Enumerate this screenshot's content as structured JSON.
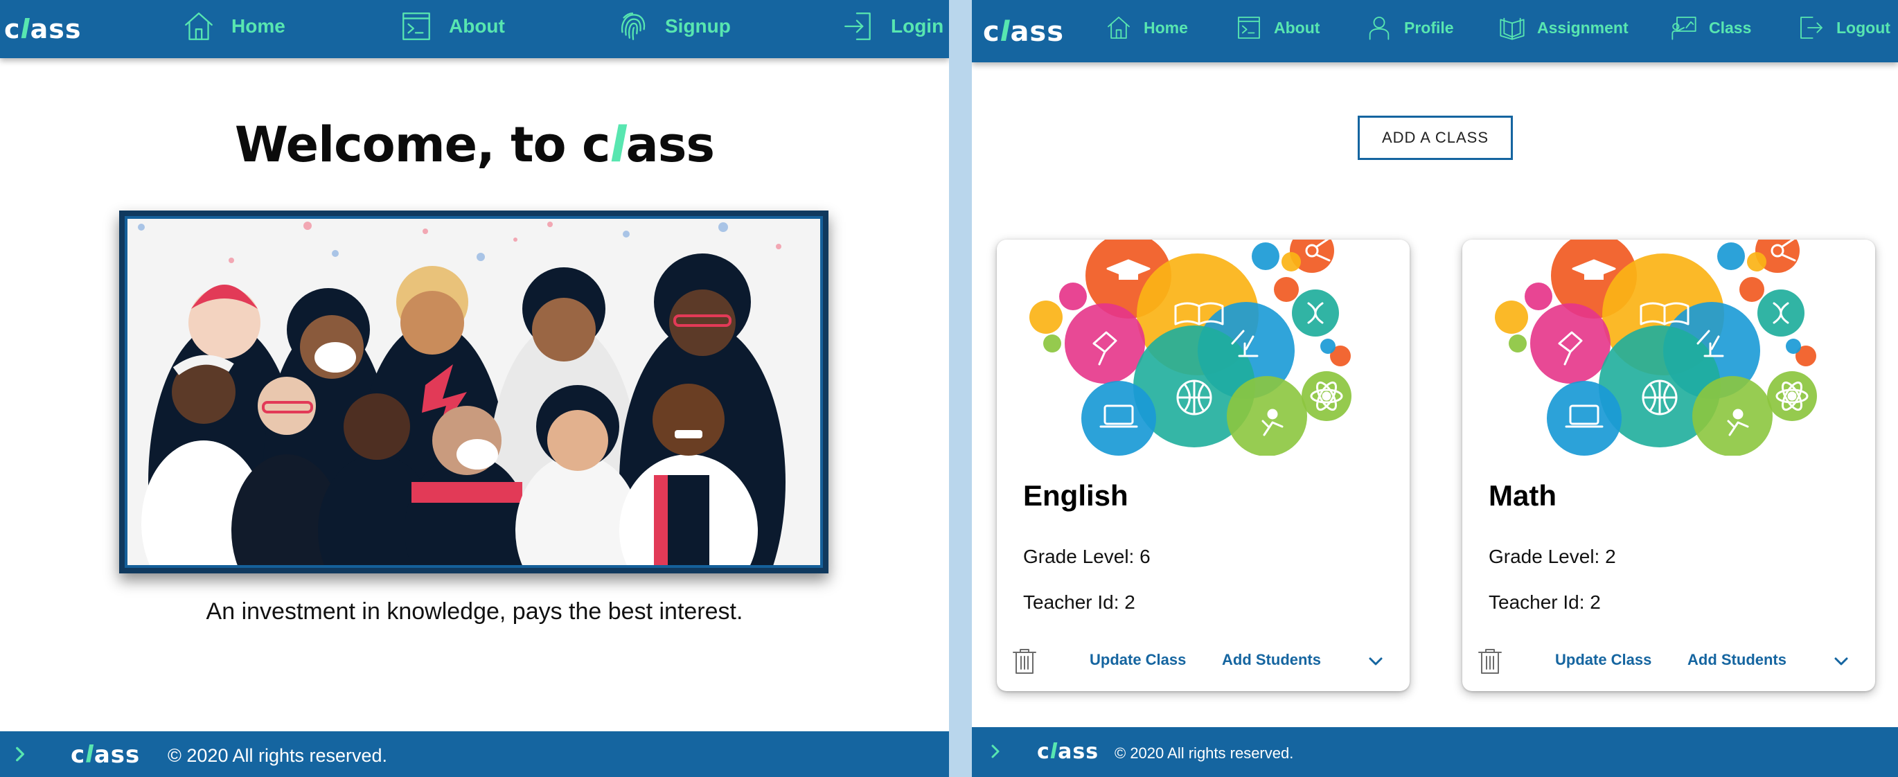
{
  "colors": {
    "nav_bg": "#1565a0",
    "accent": "#58e6b0",
    "divider": "#b9d6ec",
    "link": "#1565a0"
  },
  "logo": {
    "pre": "c",
    "accent": "l",
    "post": "ass"
  },
  "left_page": {
    "nav": [
      {
        "icon": "home-icon",
        "label": "Home"
      },
      {
        "icon": "terminal-icon",
        "label": "About"
      },
      {
        "icon": "fingerprint-icon",
        "label": "Signup"
      },
      {
        "icon": "login-icon",
        "label": "Login"
      }
    ],
    "hero": {
      "title_prefix": "Welcome, to c",
      "title_accent": "l",
      "title_suffix": "ass",
      "image_icon": "diverse-students-illustration",
      "tagline": "An investment in knowledge, pays the best interest."
    },
    "footer": {
      "copyright": "© 2020 All rights reserved."
    }
  },
  "right_page": {
    "nav": [
      {
        "icon": "home-icon",
        "label": "Home"
      },
      {
        "icon": "terminal-icon",
        "label": "About"
      },
      {
        "icon": "user-icon",
        "label": "Profile"
      },
      {
        "icon": "book-icon",
        "label": "Assignment"
      },
      {
        "icon": "presentation-icon",
        "label": "Class"
      },
      {
        "icon": "logout-icon",
        "label": "Logout"
      }
    ],
    "add_class_label": "ADD A CLASS",
    "classes": [
      {
        "name": "English",
        "grade": "Grade Level: 6",
        "teacher": "Teacher Id: 2",
        "update_label": "Update Class",
        "students_label": "Add Students"
      },
      {
        "name": "Math",
        "grade": "Grade Level: 2",
        "teacher": "Teacher Id: 2",
        "update_label": "Update Class",
        "students_label": "Add Students"
      }
    ],
    "card_image_icon": "education-bubbles-illustration",
    "footer": {
      "copyright": "© 2020 All rights reserved."
    }
  }
}
